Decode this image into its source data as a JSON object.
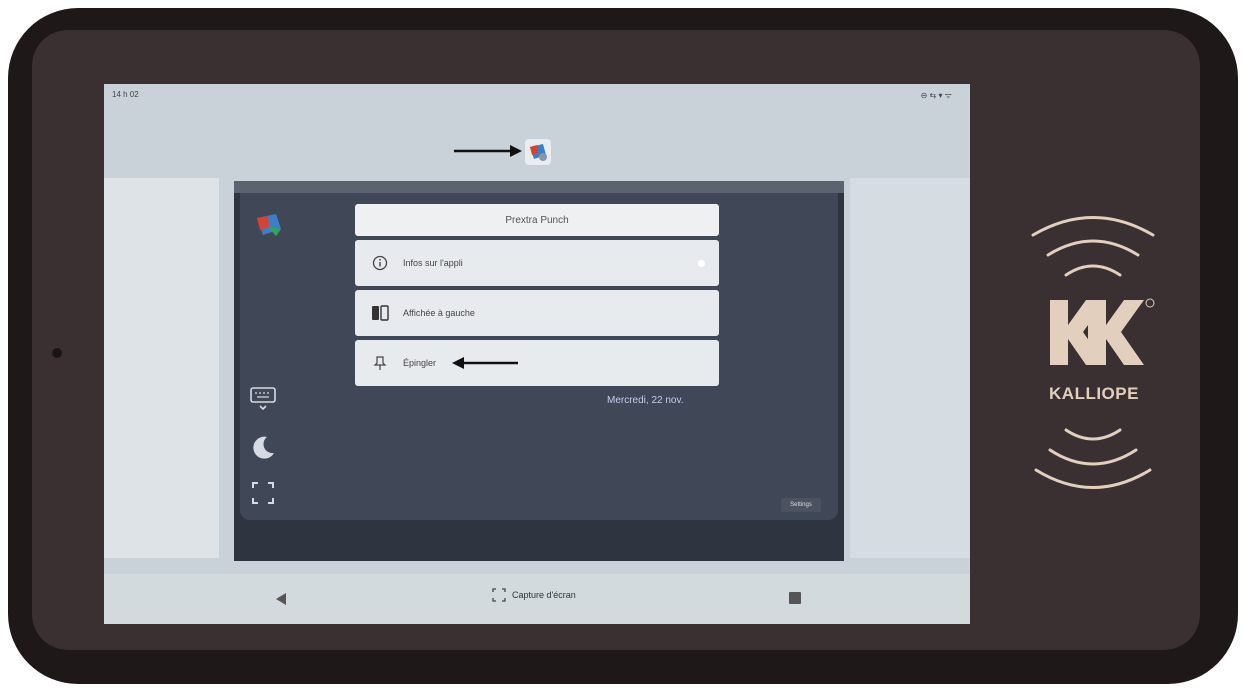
{
  "status": {
    "time": "14 h 02",
    "right": "⊖ ⇆ ▾ ᯤ"
  },
  "menu": {
    "title": "Prextra Punch",
    "items": [
      {
        "label": "Infos sur l'appli",
        "icon": "info-icon"
      },
      {
        "label": "Affichée à gauche",
        "icon": "split-screen-icon"
      },
      {
        "label": "Épingler",
        "icon": "pin-icon"
      }
    ]
  },
  "app": {
    "date": "Mercredi, 22 nov.",
    "settings_label": "Settings"
  },
  "nav": {
    "capture_label": "Capture d'écran"
  },
  "brand": {
    "name": "KALLIOPE",
    "mark": "K",
    "registered": "®"
  },
  "colors": {
    "device": "#1e1819",
    "bezel": "#3a2f31",
    "brand": "#e2cfbd",
    "app_bg": "#404858"
  }
}
